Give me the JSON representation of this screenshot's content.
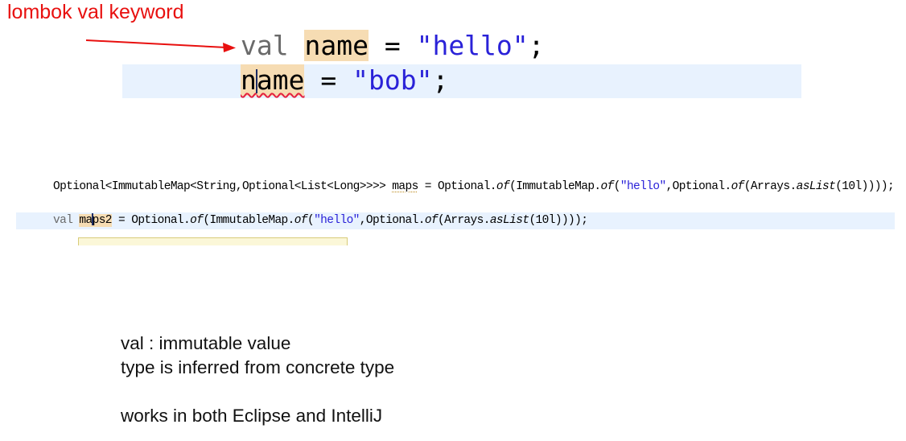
{
  "callout": {
    "label": "lombok val keyword",
    "color": "#e8100f",
    "arrow_icon": "right-arrow-icon"
  },
  "big_code": {
    "line1": {
      "keyword": "val",
      "space1": " ",
      "var": "name",
      "op": " = ",
      "string": "\"hello\"",
      "end": ";"
    },
    "line2": {
      "var_pre": "n",
      "var_post": "ame",
      "op": " = ",
      "string": "\"bob\"",
      "end": ";"
    }
  },
  "small_code": {
    "line1": {
      "type": "Optional<ImmutableMap<String,Optional<List<Long>>>> ",
      "var": "maps",
      "p1": " = Optional.",
      "of1": "of",
      "p2": "(ImmutableMap.",
      "of2": "of",
      "p3": "(",
      "string": "\"hello\"",
      "p4": ",Optional.",
      "of3": "of",
      "p5": "(Arrays.",
      "aslist": "asList",
      "p6": "(10l))));"
    },
    "line2": {
      "keyword": "val ",
      "var_pre": "ma",
      "var_post": "ps2",
      "p1": " = Optional.",
      "of1": "of",
      "p2": "(ImmutableMap.",
      "of2": "of",
      "p3": "(",
      "string": "\"hello\"",
      "p4": ",Optional.",
      "of3": "of",
      "p5": "(Arrays.",
      "aslist": "asList",
      "p6": "(10l))));"
    }
  },
  "notes": {
    "line1": "val : immutable value",
    "line2": "type is inferred from concrete type",
    "line3": "works in both Eclipse and IntelliJ"
  },
  "colors": {
    "string": "#2a22d8",
    "highlight": "#f6dcb3",
    "current_line": "#e8f2fe",
    "error_squiggle": "#e4203e"
  }
}
